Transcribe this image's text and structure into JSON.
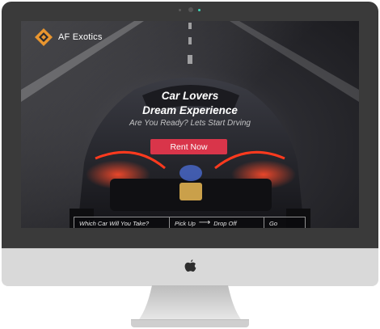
{
  "site": {
    "brand": "AF Exotics",
    "headline_line1": "Car Lovers",
    "headline_line2": "Dream Experience",
    "tagline": "Are You Ready? Lets Start Drving",
    "cta_label": "Rent Now"
  },
  "booking_bar": {
    "car_select_label": "Which Car Will You Take?",
    "pickup_label": "Pick Up",
    "arrow_icon": "arrow-right-icon",
    "dropoff_label": "Drop Off",
    "go_label": "Go"
  },
  "colors": {
    "accent": "#d9354a",
    "logo_orange": "#e8952f",
    "bezel": "#3a3a3a",
    "camera_led": "#3dd6b8"
  },
  "icons": {
    "logo": "diamond-logo-icon",
    "device": "apple-logo-icon"
  }
}
